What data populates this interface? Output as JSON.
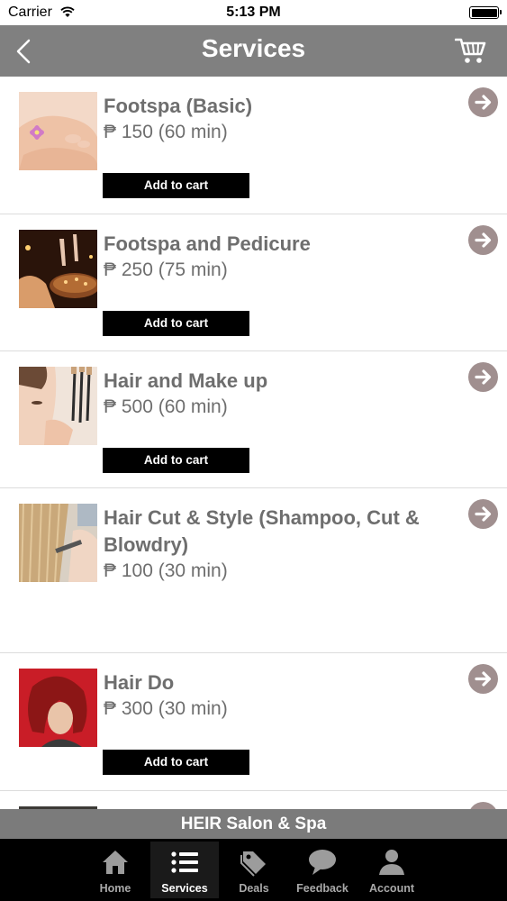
{
  "status_bar": {
    "carrier": "Carrier",
    "time": "5:13 PM"
  },
  "nav": {
    "title": "Services",
    "back_icon": "chevron-left-icon",
    "cart_icon": "cart-icon"
  },
  "currency_symbol": "₱",
  "services": [
    {
      "name": "Footspa (Basic)",
      "price": "₱ 150 (60 min)",
      "button": "Add to cart",
      "image": "feet-flower"
    },
    {
      "name": "Footspa and Pedicure",
      "price": "₱ 250 (75 min)",
      "button": "Add to cart",
      "image": "pedicure-candles"
    },
    {
      "name": "Hair and Make up",
      "price": "₱ 500 (60 min)",
      "button": "Add to cart",
      "image": "makeup-brushes"
    },
    {
      "name": "Hair Cut & Style (Shampoo, Cut & Blowdry)",
      "price": "₱ 100 (30 min)",
      "button": "",
      "image": "hair-comb"
    },
    {
      "name": "Hair Do",
      "price": "₱ 300 (30 min)",
      "button": "Add to cart",
      "image": "red-bob"
    }
  ],
  "banner": "HEIR Salon & Spa",
  "tabs": [
    {
      "label": "Home",
      "icon": "home-icon",
      "active": false
    },
    {
      "label": "Services",
      "icon": "list-icon",
      "active": true
    },
    {
      "label": "Deals",
      "icon": "tag-icon",
      "active": false
    },
    {
      "label": "Feedback",
      "icon": "speech-bubble-icon",
      "active": false
    },
    {
      "label": "Account",
      "icon": "person-icon",
      "active": false
    }
  ],
  "colors": {
    "nav_bg": "#808080",
    "tab_bg": "#000000",
    "arrow_bg": "#a08f8f",
    "text_gray": "#6e6e6e"
  }
}
